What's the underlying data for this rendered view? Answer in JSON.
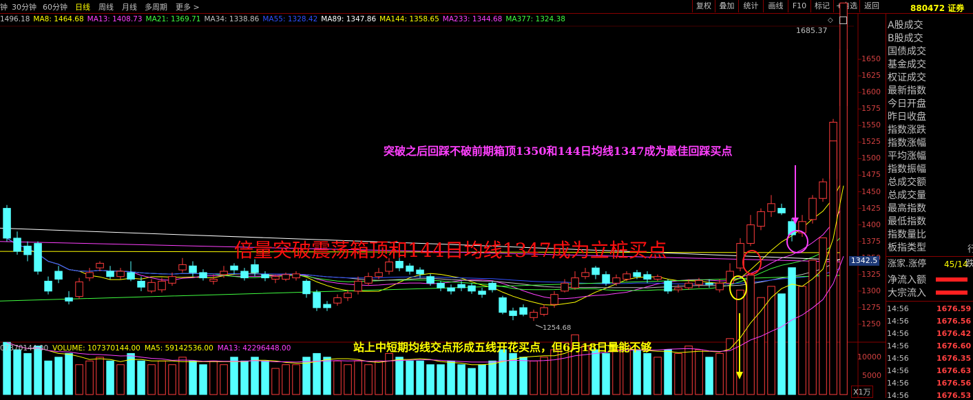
{
  "toolbar": {
    "periods": [
      "钟",
      "30分钟",
      "60分钟",
      "日线",
      "周线",
      "月线",
      "多周期",
      "更多 >"
    ],
    "active_period": "日线",
    "buttons": [
      "复权",
      "叠加",
      "统计",
      "画线",
      "F10",
      "标记",
      "+自选",
      "返回"
    ],
    "code": "880472 证券"
  },
  "ma_legend": [
    {
      "text": "1496.18",
      "color": "#c0c0c0"
    },
    {
      "text": "MA8: 1464.68",
      "color": "#ffff00"
    },
    {
      "text": "MA13: 1408.73",
      "color": "#ff40ff"
    },
    {
      "text": "MA21: 1369.71",
      "color": "#40ff40"
    },
    {
      "text": "MA34: 1338.86",
      "color": "#c0c0c0"
    },
    {
      "text": "MA55: 1328.42",
      "color": "#3050ff"
    },
    {
      "text": "MA89: 1347.86",
      "color": "#ffffff"
    },
    {
      "text": "MA144: 1358.65",
      "color": "#ffff00"
    },
    {
      "text": "MA233: 1344.68",
      "color": "#ff40ff"
    },
    {
      "text": "MA377: 1324.38",
      "color": "#40ff40"
    }
  ],
  "volume_legend": [
    {
      "text": "07370144.00",
      "color": "#c0c0c0"
    },
    {
      "text": "VOLUME: 107370144.00",
      "color": "#ffff00"
    },
    {
      "text": "MA5: 59142536.00",
      "color": "#ffff00"
    },
    {
      "text": "MA13: 42296448.00",
      "color": "#ff40ff"
    }
  ],
  "chart_data": {
    "type": "candlestick",
    "price_axis": {
      "min": 1225,
      "max": 1700,
      "ticks": [
        1250,
        1275,
        1300,
        1325,
        1350,
        1375,
        1400,
        1425,
        1450,
        1475,
        1500,
        1525,
        1550,
        1575,
        1600,
        1625,
        1650
      ]
    },
    "volume_axis": {
      "max": 12000,
      "ticks": [
        5000,
        10000
      ],
      "unit": "X1万"
    },
    "high_marker": "1685.37",
    "low_marker": "1254.68",
    "current_price": "1342.5",
    "candles": [
      [
        1425,
        1380,
        1430,
        1375
      ],
      [
        1380,
        1360,
        1390,
        1355
      ],
      [
        1368,
        1355,
        1375,
        1345
      ],
      [
        1372,
        1330,
        1375,
        1325
      ],
      [
        1315,
        1300,
        1322,
        1295
      ],
      [
        1330,
        1318,
        1338,
        1312
      ],
      [
        1290,
        1285,
        1300,
        1280
      ],
      [
        1292,
        1314,
        1320,
        1288
      ],
      [
        1320,
        1328,
        1335,
        1315
      ],
      [
        1335,
        1342,
        1345,
        1330
      ],
      [
        1330,
        1322,
        1338,
        1318
      ],
      [
        1322,
        1330,
        1335,
        1318
      ],
      [
        1328,
        1318,
        1345,
        1315
      ],
      [
        1315,
        1306,
        1322,
        1300
      ],
      [
        1300,
        1313,
        1318,
        1297
      ],
      [
        1302,
        1315,
        1320,
        1298
      ],
      [
        1312,
        1322,
        1328,
        1308
      ],
      [
        1332,
        1340,
        1350,
        1328
      ],
      [
        1338,
        1328,
        1345,
        1322
      ],
      [
        1328,
        1320,
        1333,
        1316
      ],
      [
        1315,
        1318,
        1325,
        1310
      ],
      [
        1325,
        1330,
        1338,
        1320
      ],
      [
        1338,
        1332,
        1342,
        1325
      ],
      [
        1330,
        1320,
        1335,
        1316
      ],
      [
        1340,
        1328,
        1348,
        1322
      ],
      [
        1325,
        1320,
        1330,
        1315
      ],
      [
        1318,
        1322,
        1325,
        1312
      ],
      [
        1318,
        1325,
        1328,
        1315
      ],
      [
        1320,
        1326,
        1330,
        1316
      ],
      [
        1315,
        1296,
        1318,
        1290
      ],
      [
        1298,
        1275,
        1302,
        1270
      ],
      [
        1280,
        1275,
        1285,
        1270
      ],
      [
        1282,
        1290,
        1295,
        1278
      ],
      [
        1290,
        1297,
        1302,
        1285
      ],
      [
        1300,
        1315,
        1322,
        1295
      ],
      [
        1312,
        1322,
        1328,
        1308
      ],
      [
        1322,
        1328,
        1335,
        1318
      ],
      [
        1330,
        1344,
        1350,
        1325
      ],
      [
        1345,
        1335,
        1350,
        1330
      ],
      [
        1338,
        1330,
        1342,
        1325
      ],
      [
        1332,
        1326,
        1336,
        1320
      ],
      [
        1322,
        1312,
        1326,
        1308
      ],
      [
        1312,
        1305,
        1315,
        1300
      ],
      [
        1305,
        1300,
        1310,
        1295
      ],
      [
        1310,
        1305,
        1315,
        1300
      ],
      [
        1308,
        1300,
        1312,
        1296
      ],
      [
        1300,
        1295,
        1305,
        1290
      ],
      [
        1312,
        1302,
        1315,
        1298
      ],
      [
        1290,
        1268,
        1293,
        1265
      ],
      [
        1270,
        1263,
        1275,
        1256
      ],
      [
        1275,
        1265,
        1280,
        1262
      ],
      [
        1260,
        1268,
        1272,
        1255
      ],
      [
        1265,
        1275,
        1280,
        1262
      ],
      [
        1280,
        1295,
        1300,
        1275
      ],
      [
        1300,
        1312,
        1318,
        1298
      ],
      [
        1305,
        1320,
        1330,
        1302
      ],
      [
        1322,
        1328,
        1335,
        1318
      ],
      [
        1335,
        1325,
        1338,
        1318
      ],
      [
        1325,
        1312,
        1330,
        1308
      ],
      [
        1312,
        1320,
        1325,
        1308
      ],
      [
        1318,
        1326,
        1330,
        1315
      ],
      [
        1328,
        1322,
        1332,
        1318
      ],
      [
        1325,
        1318,
        1330,
        1312
      ],
      [
        1318,
        1322,
        1325,
        1315
      ],
      [
        1315,
        1300,
        1318,
        1296
      ],
      [
        1302,
        1305,
        1310,
        1298
      ],
      [
        1305,
        1312,
        1318,
        1302
      ],
      [
        1310,
        1316,
        1320,
        1305
      ],
      [
        1312,
        1310,
        1318,
        1305
      ],
      [
        1302,
        1312,
        1318,
        1298
      ],
      [
        1312,
        1330,
        1342,
        1308
      ],
      [
        1335,
        1372,
        1380,
        1330
      ],
      [
        1372,
        1400,
        1415,
        1368
      ],
      [
        1398,
        1420,
        1425,
        1392
      ],
      [
        1420,
        1432,
        1445,
        1412
      ],
      [
        1425,
        1418,
        1432,
        1415
      ],
      [
        1405,
        1385,
        1410,
        1375
      ],
      [
        1388,
        1405,
        1415,
        1382
      ],
      [
        1408,
        1440,
        1445,
        1402
      ],
      [
        1440,
        1465,
        1470,
        1435
      ],
      [
        1470,
        1555,
        1560,
        1465
      ],
      [
        1580,
        1665,
        1685.37,
        1575
      ]
    ],
    "volumes": [
      1.4,
      1.2,
      1.1,
      1.3,
      0.9,
      1.0,
      1.1,
      0.8,
      0.9,
      1.0,
      0.9,
      0.8,
      1.1,
      0.9,
      0.8,
      0.9,
      0.8,
      1.0,
      0.9,
      0.8,
      0.9,
      0.8,
      1.0,
      0.9,
      1.0,
      0.9,
      0.7,
      0.8,
      0.8,
      1.0,
      1.1,
      1.0,
      0.9,
      0.8,
      0.9,
      0.8,
      0.9,
      1.1,
      1.0,
      0.9,
      0.9,
      0.8,
      0.8,
      0.9,
      0.8,
      0.7,
      0.8,
      0.9,
      1.2,
      1.1,
      1.0,
      0.9,
      1.0,
      1.2,
      1.4,
      1.6,
      1.3,
      1.2,
      1.1,
      1.2,
      1.3,
      1.2,
      1.1,
      1.0,
      1.2,
      1.1,
      1.3,
      1.2,
      1.0,
      1.1,
      1.5,
      2.8,
      3.2,
      2.6,
      2.9,
      2.7,
      3.4,
      2.9,
      3.6,
      4.2,
      6.8,
      10.5
    ]
  },
  "annotations": {
    "breakout_retest": "突破之后回踩不破前期箱顶1350和144日均线1347成为最佳回踩买点",
    "breakout": "倍量突破震荡箱顶和144日均线1347成为立桩买点",
    "five_lines": "站上中短期均线交点形成五线开花买点，但6月18日量能不够"
  },
  "sidebar": {
    "items": [
      "A股成交",
      "B股成交",
      "国债成交",
      "基金成交",
      "权证成交",
      "最新指数",
      "今日开盘",
      "昨日收盘",
      "指数涨跌",
      "指数涨幅",
      "平均涨幅",
      "指数振幅",
      "总成交额",
      "总成交量",
      "最高指数",
      "最低指数",
      "指数量比",
      "板指类型"
    ],
    "rise_fall_label": "涨家.涨停",
    "rise_fall_value": "45/14",
    "rise_fall_tail": "跌",
    "net_inflow_label": "净流入额",
    "block_inflow_label": "大宗流入",
    "tail_glyph": "行"
  },
  "ticks": [
    {
      "time": "14:56",
      "price": "1676.59"
    },
    {
      "time": "14:56",
      "price": "1676.56"
    },
    {
      "time": "14:56",
      "price": "1676.42"
    },
    {
      "time": "14:56",
      "price": "1676.60"
    },
    {
      "time": "14:56",
      "price": "1676.35"
    },
    {
      "time": "14:56",
      "price": "1676.63"
    },
    {
      "time": "14:56",
      "price": "1676.56"
    },
    {
      "time": "14:56",
      "price": "1676.53"
    }
  ]
}
